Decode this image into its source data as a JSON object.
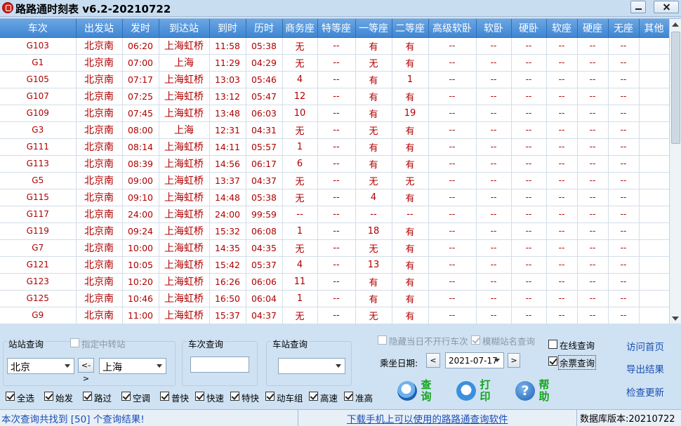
{
  "window": {
    "title": "路路通时刻表 v6.2-20210722"
  },
  "table": {
    "columns": [
      "车次",
      "出发站",
      "发时",
      "到达站",
      "到时",
      "历时",
      "商务座",
      "特等座",
      "一等座",
      "二等座",
      "高级软卧",
      "软卧",
      "硬卧",
      "软座",
      "硬座",
      "无座",
      "其他"
    ],
    "rows": [
      [
        "G103",
        "北京南",
        "06:20",
        "上海虹桥",
        "11:58",
        "05:38",
        "无",
        "--",
        "有",
        "有",
        "--",
        "--",
        "--",
        "--",
        "--",
        "--",
        ""
      ],
      [
        "G1",
        "北京南",
        "07:00",
        "上海",
        "11:29",
        "04:29",
        "无",
        "--",
        "无",
        "有",
        "--",
        "--",
        "--",
        "--",
        "--",
        "--",
        ""
      ],
      [
        "G105",
        "北京南",
        "07:17",
        "上海虹桥",
        "13:03",
        "05:46",
        "4",
        "--",
        "有",
        "1",
        "--",
        "--",
        "--",
        "--",
        "--",
        "--",
        ""
      ],
      [
        "G107",
        "北京南",
        "07:25",
        "上海虹桥",
        "13:12",
        "05:47",
        "12",
        "--",
        "有",
        "有",
        "--",
        "--",
        "--",
        "--",
        "--",
        "--",
        ""
      ],
      [
        "G109",
        "北京南",
        "07:45",
        "上海虹桥",
        "13:48",
        "06:03",
        "10",
        "--",
        "有",
        "19",
        "--",
        "--",
        "--",
        "--",
        "--",
        "--",
        ""
      ],
      [
        "G3",
        "北京南",
        "08:00",
        "上海",
        "12:31",
        "04:31",
        "无",
        "--",
        "无",
        "有",
        "--",
        "--",
        "--",
        "--",
        "--",
        "--",
        ""
      ],
      [
        "G111",
        "北京南",
        "08:14",
        "上海虹桥",
        "14:11",
        "05:57",
        "1",
        "--",
        "有",
        "有",
        "--",
        "--",
        "--",
        "--",
        "--",
        "--",
        ""
      ],
      [
        "G113",
        "北京南",
        "08:39",
        "上海虹桥",
        "14:56",
        "06:17",
        "6",
        "--",
        "有",
        "有",
        "--",
        "--",
        "--",
        "--",
        "--",
        "--",
        ""
      ],
      [
        "G5",
        "北京南",
        "09:00",
        "上海虹桥",
        "13:37",
        "04:37",
        "无",
        "--",
        "无",
        "无",
        "--",
        "--",
        "--",
        "--",
        "--",
        "--",
        ""
      ],
      [
        "G115",
        "北京南",
        "09:10",
        "上海虹桥",
        "14:48",
        "05:38",
        "无",
        "--",
        "4",
        "有",
        "--",
        "--",
        "--",
        "--",
        "--",
        "--",
        ""
      ],
      [
        "G117",
        "北京南",
        "24:00",
        "上海虹桥",
        "24:00",
        "99:59",
        "--",
        "--",
        "--",
        "--",
        "--",
        "--",
        "--",
        "--",
        "--",
        "--",
        ""
      ],
      [
        "G119",
        "北京南",
        "09:24",
        "上海虹桥",
        "15:32",
        "06:08",
        "1",
        "--",
        "18",
        "有",
        "--",
        "--",
        "--",
        "--",
        "--",
        "--",
        ""
      ],
      [
        "G7",
        "北京南",
        "10:00",
        "上海虹桥",
        "14:35",
        "04:35",
        "无",
        "--",
        "无",
        "有",
        "--",
        "--",
        "--",
        "--",
        "--",
        "--",
        ""
      ],
      [
        "G121",
        "北京南",
        "10:05",
        "上海虹桥",
        "15:42",
        "05:37",
        "4",
        "--",
        "13",
        "有",
        "--",
        "--",
        "--",
        "--",
        "--",
        "--",
        ""
      ],
      [
        "G123",
        "北京南",
        "10:20",
        "上海虹桥",
        "16:26",
        "06:06",
        "11",
        "--",
        "有",
        "有",
        "--",
        "--",
        "--",
        "--",
        "--",
        "--",
        ""
      ],
      [
        "G125",
        "北京南",
        "10:46",
        "上海虹桥",
        "16:50",
        "06:04",
        "1",
        "--",
        "有",
        "有",
        "--",
        "--",
        "--",
        "--",
        "--",
        "--",
        ""
      ],
      [
        "G9",
        "北京南",
        "11:00",
        "上海虹桥",
        "15:37",
        "04:37",
        "无",
        "--",
        "无",
        "有",
        "--",
        "--",
        "--",
        "--",
        "--",
        "--",
        ""
      ]
    ]
  },
  "station_query": {
    "label": "站站查询",
    "transfer_label": "指定中转站",
    "from": "北京",
    "swap_label": "<->",
    "to": "上海"
  },
  "train_query": {
    "label": "车次查询",
    "value": ""
  },
  "station_search": {
    "label": "车站查询",
    "value": ""
  },
  "options": {
    "hide_label": "隐藏当日不开行车次",
    "fuzzy_label": "模糊站名查询",
    "online_label": "在线查询",
    "remaining_label": "余票查询",
    "date_label": "乘坐日期:",
    "date_value": "2021-07-17",
    "prev_label": "<",
    "next_label": ">"
  },
  "filters": [
    "全选",
    "始发",
    "路过",
    "空调",
    "普快",
    "快速",
    "特快",
    "动车组",
    "高速",
    "准高"
  ],
  "actions": {
    "search_label": "查询",
    "print_label": "打印",
    "help_label": "帮助",
    "help_glyph": "?"
  },
  "links": {
    "home": "访问首页",
    "export": "导出结果",
    "update": "检查更新"
  },
  "status": {
    "result": "本次查询共找到 [50] 个查询结果!",
    "download": "下载手机上可以使用的路路通查询软件",
    "db_version": "数据库版本:20210722"
  },
  "colors": {
    "header": "#4a90d9",
    "cell_text": "#b00000",
    "action_text": "#15a51d",
    "link": "#1b4fb3",
    "panel_bg": "#cfe2f3"
  }
}
